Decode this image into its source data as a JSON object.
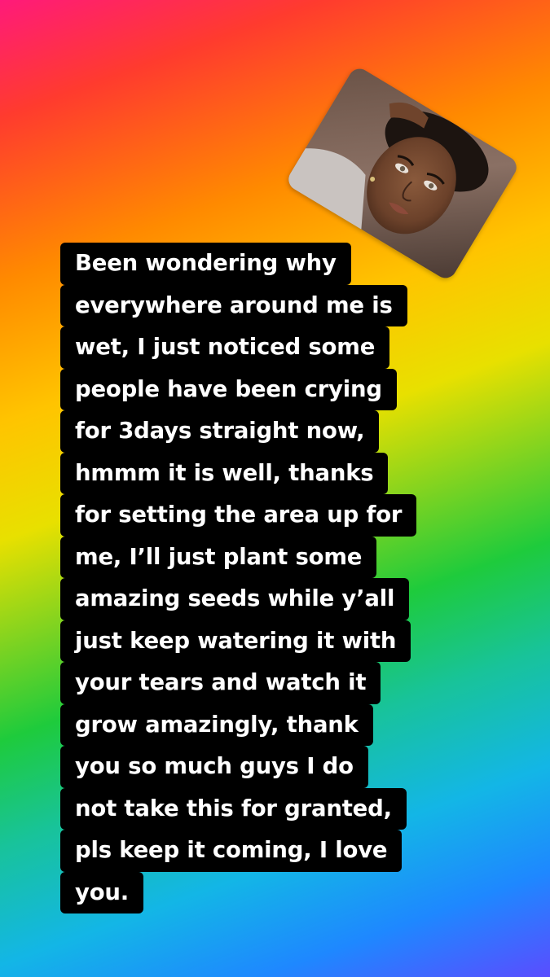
{
  "story": {
    "background_gradient": [
      "#ff1a7a",
      "#ff8a00",
      "#ffc400",
      "#1ecb3c",
      "#13b6e6",
      "#5a4dff"
    ],
    "sticker": {
      "type": "photo",
      "subject": "portrait-photo"
    },
    "text_lines": [
      "Been wondering why",
      "everywhere around me is",
      "wet, I just noticed some",
      "people have been crying",
      "for 3days straight now,",
      "hmmm it is well, thanks",
      "for setting the area up for",
      "me, I’ll just plant some",
      "amazing seeds while y’all",
      "just keep watering it with",
      "your tears and watch it",
      "grow amazingly, thank",
      "you so much guys I do",
      "not take this for granted,",
      "pls keep it coming, I love",
      "you."
    ],
    "text_color": "#ffffff",
    "text_highlight_color": "#000000"
  }
}
